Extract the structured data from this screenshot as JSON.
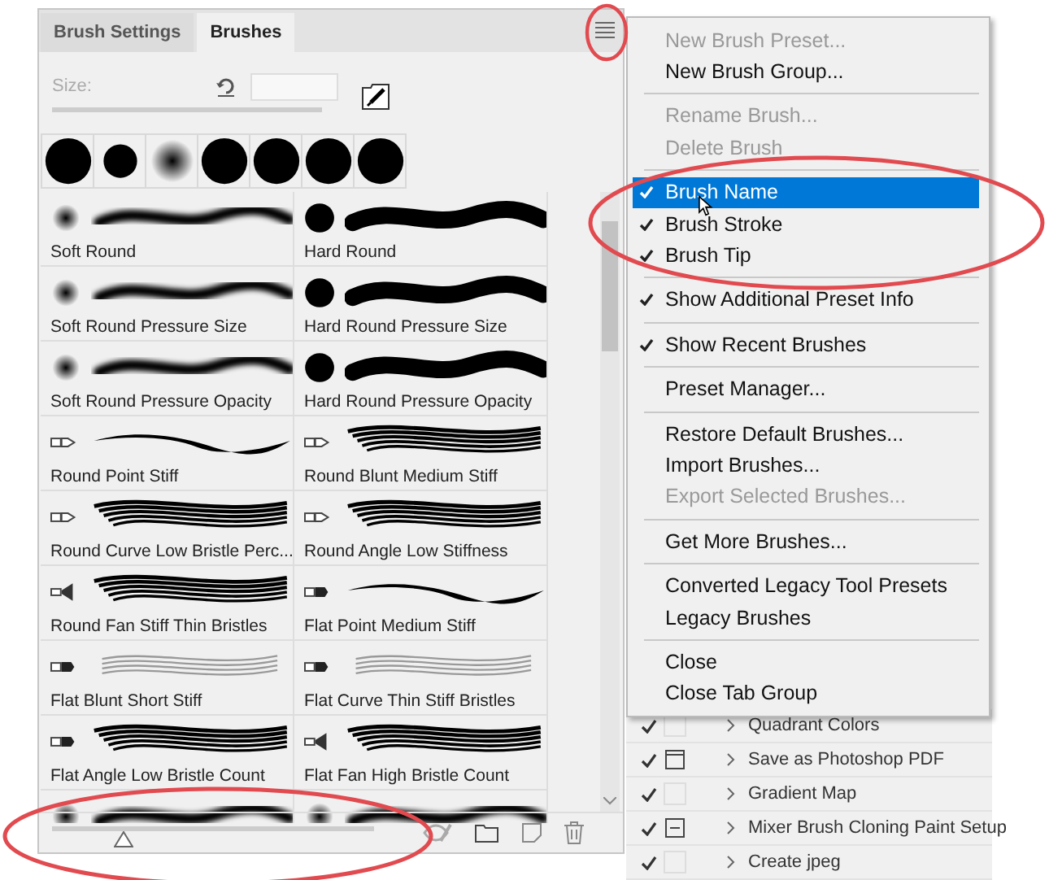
{
  "panel": {
    "tabs": [
      {
        "label": "Brush Settings",
        "selected": false
      },
      {
        "label": "Brushes",
        "selected": true
      }
    ],
    "size_label": "Size:",
    "recent_tips": [
      {
        "kind": "hard"
      },
      {
        "kind": "small"
      },
      {
        "kind": "soft"
      },
      {
        "kind": "hard"
      },
      {
        "kind": "hard"
      },
      {
        "kind": "hard"
      },
      {
        "kind": "hard"
      }
    ],
    "brushes": [
      {
        "name": "Soft Round",
        "tip": {
          "kind": "soft"
        },
        "stroke": {
          "kind": "soft"
        }
      },
      {
        "name": "Hard Round",
        "tip": {
          "kind": "hard"
        },
        "stroke": {
          "kind": "hard"
        }
      },
      {
        "name": "Soft Round Pressure Size",
        "tip": {
          "kind": "soft"
        },
        "stroke": {
          "kind": "soft"
        }
      },
      {
        "name": "Hard Round Pressure Size",
        "tip": {
          "kind": "hard"
        },
        "stroke": {
          "kind": "hard"
        }
      },
      {
        "name": "Soft Round Pressure Opacity",
        "tip": {
          "kind": "soft"
        },
        "stroke": {
          "kind": "soft"
        }
      },
      {
        "name": "Hard Round Pressure Opacity",
        "tip": {
          "kind": "hard"
        },
        "stroke": {
          "kind": "hard"
        }
      },
      {
        "name": "Round Point Stiff",
        "tip": {
          "kind": "bristle"
        },
        "stroke": {
          "kind": "thin"
        }
      },
      {
        "name": "Round Blunt Medium Stiff",
        "tip": {
          "kind": "bristle"
        },
        "stroke": {
          "kind": "bristle"
        }
      },
      {
        "name": "Round Curve Low Bristle Perc...",
        "tip": {
          "kind": "bristle"
        },
        "stroke": {
          "kind": "bristle"
        }
      },
      {
        "name": "Round Angle Low Stiffness",
        "tip": {
          "kind": "bristle"
        },
        "stroke": {
          "kind": "bristle"
        }
      },
      {
        "name": "Round Fan Stiff Thin Bristles",
        "tip": {
          "kind": "fan"
        },
        "stroke": {
          "kind": "bristle"
        }
      },
      {
        "name": "Flat Point Medium Stiff",
        "tip": {
          "kind": "flat"
        },
        "stroke": {
          "kind": "thin"
        }
      },
      {
        "name": "Flat Blunt Short Stiff",
        "tip": {
          "kind": "flat"
        },
        "stroke": {
          "kind": "light"
        }
      },
      {
        "name": "Flat Curve Thin Stiff Bristles",
        "tip": {
          "kind": "flat"
        },
        "stroke": {
          "kind": "light"
        }
      },
      {
        "name": "Flat Angle Low Bristle Count",
        "tip": {
          "kind": "flat"
        },
        "stroke": {
          "kind": "bristle"
        }
      },
      {
        "name": "Flat Fan High Bristle Count",
        "tip": {
          "kind": "fan"
        },
        "stroke": {
          "kind": "bristle"
        }
      },
      {
        "tip": {
          "kind": "soft"
        },
        "stroke": {
          "kind": "soft"
        }
      },
      {
        "tip": {
          "kind": "soft"
        },
        "stroke": {
          "kind": "soft"
        }
      }
    ],
    "preview_size": {
      "level": 0.22
    }
  },
  "menu": {
    "sections": [
      [
        {
          "label": "New Brush Preset...",
          "disabled": true,
          "checked": false,
          "selected": false
        },
        {
          "label": "New Brush Group...",
          "disabled": false,
          "checked": false,
          "selected": false
        }
      ],
      [
        {
          "label": "Rename Brush...",
          "disabled": true,
          "checked": false,
          "selected": false
        },
        {
          "label": "Delete Brush",
          "disabled": true,
          "checked": false,
          "selected": false
        }
      ],
      [
        {
          "label": "Brush Name",
          "disabled": false,
          "checked": true,
          "selected": true
        },
        {
          "label": "Brush Stroke",
          "disabled": false,
          "checked": true,
          "selected": false
        },
        {
          "label": "Brush Tip",
          "disabled": false,
          "checked": true,
          "selected": false
        }
      ],
      [
        {
          "label": "Show Additional Preset Info",
          "disabled": false,
          "checked": true,
          "selected": false
        }
      ],
      [
        {
          "label": "Show Recent Brushes",
          "disabled": false,
          "checked": true,
          "selected": false
        }
      ],
      [
        {
          "label": "Preset Manager...",
          "disabled": false,
          "checked": false,
          "selected": false
        }
      ],
      [
        {
          "label": "Restore Default Brushes...",
          "disabled": false,
          "checked": false,
          "selected": false
        },
        {
          "label": "Import Brushes...",
          "disabled": false,
          "checked": false,
          "selected": false
        },
        {
          "label": "Export Selected Brushes...",
          "disabled": true,
          "checked": false,
          "selected": false
        }
      ],
      [
        {
          "label": "Get More Brushes...",
          "disabled": false,
          "checked": false,
          "selected": false
        }
      ],
      [
        {
          "label": "Converted Legacy Tool Presets",
          "disabled": false,
          "checked": false,
          "selected": false
        },
        {
          "label": "Legacy Brushes",
          "disabled": false,
          "checked": false,
          "selected": false
        }
      ],
      [
        {
          "label": "Close",
          "disabled": false,
          "checked": false,
          "selected": false
        },
        {
          "label": "Close Tab Group",
          "disabled": false,
          "checked": false,
          "selected": false
        }
      ]
    ]
  },
  "actions": [
    {
      "label": "Quadrant Colors",
      "checked": true,
      "kind": "none"
    },
    {
      "label": "Save as Photoshop PDF",
      "checked": true,
      "kind": "dialog"
    },
    {
      "label": "Gradient Map",
      "checked": true,
      "kind": "none"
    },
    {
      "label": "Mixer Brush Cloning Paint Setup",
      "checked": true,
      "kind": "partial"
    },
    {
      "label": "Create jpeg",
      "checked": true,
      "kind": "none"
    }
  ]
}
